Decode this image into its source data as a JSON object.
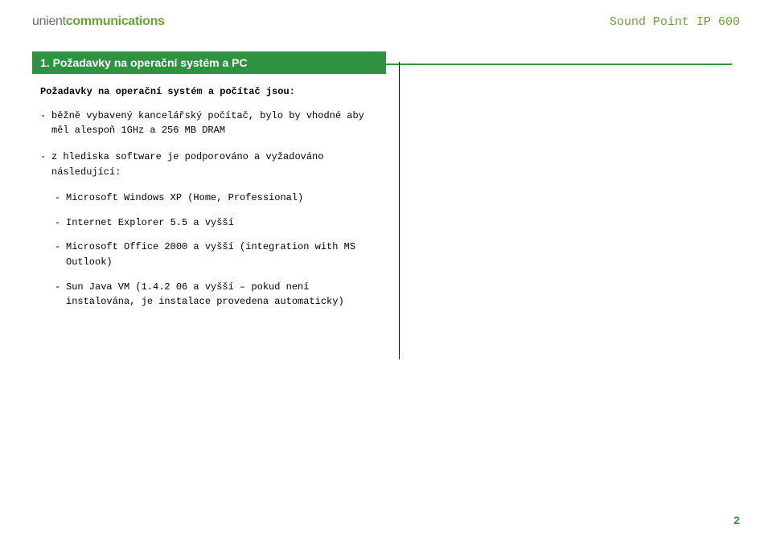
{
  "header": {
    "brand_part1": "unient",
    "brand_part2": "communications",
    "device_label": "Sound Point IP 600"
  },
  "section": {
    "title": "1. Požadavky na operační systém a PC",
    "intro": "Požadavky na operační systém a počítač jsou:",
    "bullets": [
      "běžně vybavený kancelářský počítač, bylo by vhodné aby měl alespoň 1GHz a 256 MB DRAM",
      "z hlediska software je podporováno a vyžadováno následující:"
    ],
    "sub_bullets": [
      "Microsoft Windows XP (Home, Professional)",
      "Internet Explorer 5.5 a vyšší",
      "Microsoft Office 2000 a vyšší (integration with MS Outlook)",
      "Sun Java VM (1.4.2 06 a vyšší – pokud není instalována, je instalace provedena automaticky)"
    ]
  },
  "page_number": "2"
}
